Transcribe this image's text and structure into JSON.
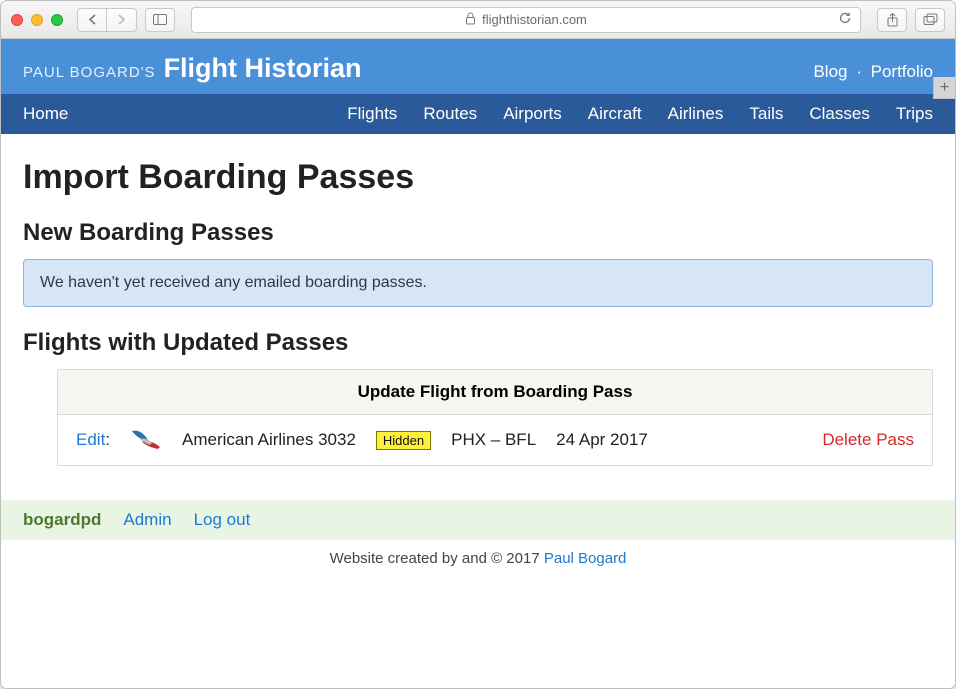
{
  "browser": {
    "domain": "flighthistorian.com"
  },
  "banner": {
    "brand_small": "PAUL BOGARD'S",
    "brand_big": "Flight Historian",
    "links": {
      "blog": "Blog",
      "portfolio": "Portfolio"
    }
  },
  "nav": {
    "home": "Home",
    "items": [
      "Flights",
      "Routes",
      "Airports",
      "Aircraft",
      "Airlines",
      "Tails",
      "Classes",
      "Trips"
    ]
  },
  "page": {
    "title": "Import Boarding Passes",
    "section_new": "New Boarding Passes",
    "empty_msg": "We haven't yet received any emailed boarding passes.",
    "section_updated": "Flights with Updated Passes"
  },
  "table": {
    "header": "Update Flight from Boarding Pass",
    "row": {
      "edit": "Edit",
      "flight": "American Airlines 3032",
      "badge": "Hidden",
      "route": "PHX – BFL",
      "date": "24 Apr 2017",
      "delete": "Delete Pass"
    }
  },
  "userbar": {
    "username": "bogardpd",
    "admin": "Admin",
    "logout": "Log out"
  },
  "footer": {
    "text": "Website created by and © 2017 ",
    "author": "Paul Bogard"
  }
}
